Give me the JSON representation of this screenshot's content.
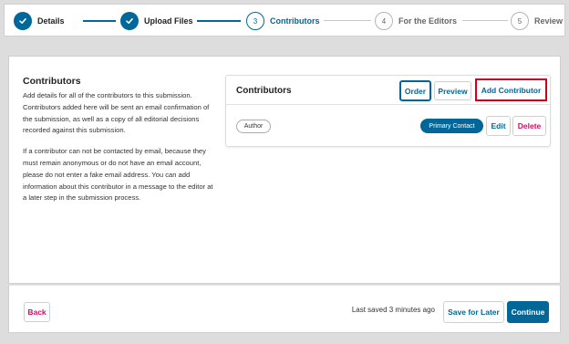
{
  "stepper": {
    "steps": [
      {
        "number": "1",
        "label": "Details",
        "state": "done"
      },
      {
        "number": "2",
        "label": "Upload Files",
        "state": "done"
      },
      {
        "number": "3",
        "label": "Contributors",
        "state": "current"
      },
      {
        "number": "4",
        "label": "For the Editors",
        "state": "future"
      },
      {
        "number": "5",
        "label": "Review",
        "state": "future"
      }
    ]
  },
  "intro": {
    "title": "Contributors",
    "paragraph1": "Add details for all of the contributors to this submission. Contributors added here will be sent an email confirmation of the submission, as well as a copy of all editorial decisions recorded against this submission.",
    "paragraph2": "If a contributor can not be contacted by email, because they must remain anonymous or do not have an email account, please do not enter a fake email address. You can add information about this contributor in a message to the editor at a later step in the submission process."
  },
  "contributors_card": {
    "title": "Contributors",
    "order_label": "Order",
    "preview_label": "Preview",
    "add_label": "Add Contributor",
    "row": {
      "role": "Author",
      "primary_contact": "Primary Contact",
      "edit_label": "Edit",
      "delete_label": "Delete"
    }
  },
  "footer": {
    "back_label": "Back",
    "saved_text": "Last saved 3 minutes ago",
    "save_later_label": "Save for Later",
    "continue_label": "Continue"
  },
  "colors": {
    "accent": "#006798",
    "danger": "#d00a6c",
    "highlight": "#d0021b"
  }
}
